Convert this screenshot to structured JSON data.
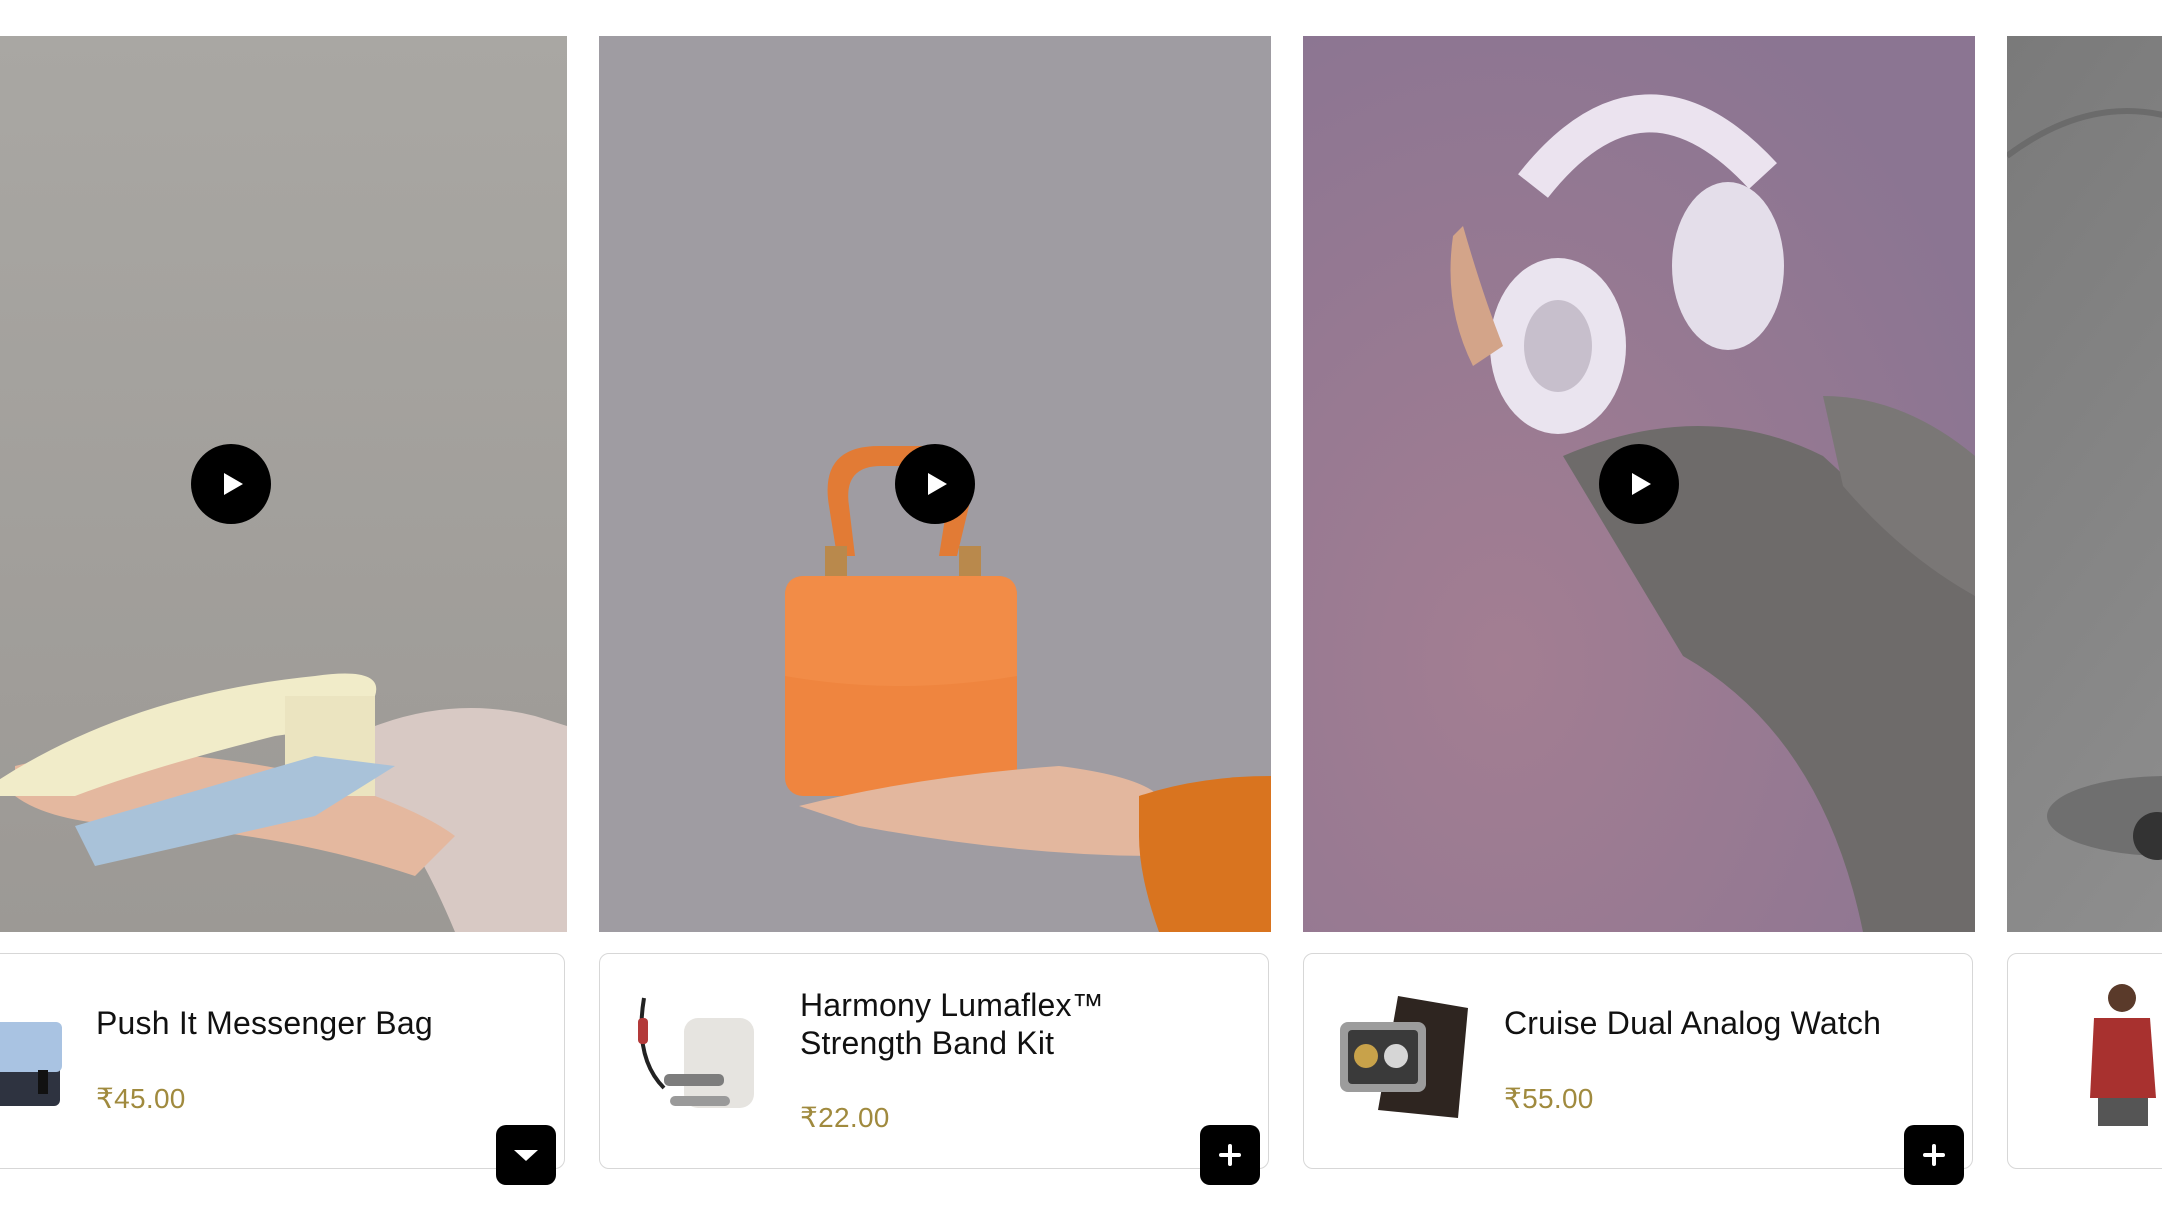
{
  "products": [
    {
      "name": "Push It Messenger Bag",
      "price": "₹45.00",
      "media_bg": "#a9a6a3",
      "button_icon": "chevron-down-icon"
    },
    {
      "name_line1": "Harmony Lumaflex™",
      "name_line2": "Strength Band Kit",
      "price": "₹22.00",
      "media_bg": "#9e9ba1",
      "button_icon": "plus-icon"
    },
    {
      "name": "Cruise Dual Analog Watch",
      "price": "₹55.00",
      "media_bg": "#9a7a98",
      "button_icon": "plus-icon"
    },
    {
      "name": "",
      "price": "",
      "media_bg": "#8c8c8c",
      "button_icon": "plus-icon"
    }
  ],
  "colors": {
    "price": "#a08a3e",
    "button": "#000000",
    "card_border": "#d7d7d7"
  }
}
